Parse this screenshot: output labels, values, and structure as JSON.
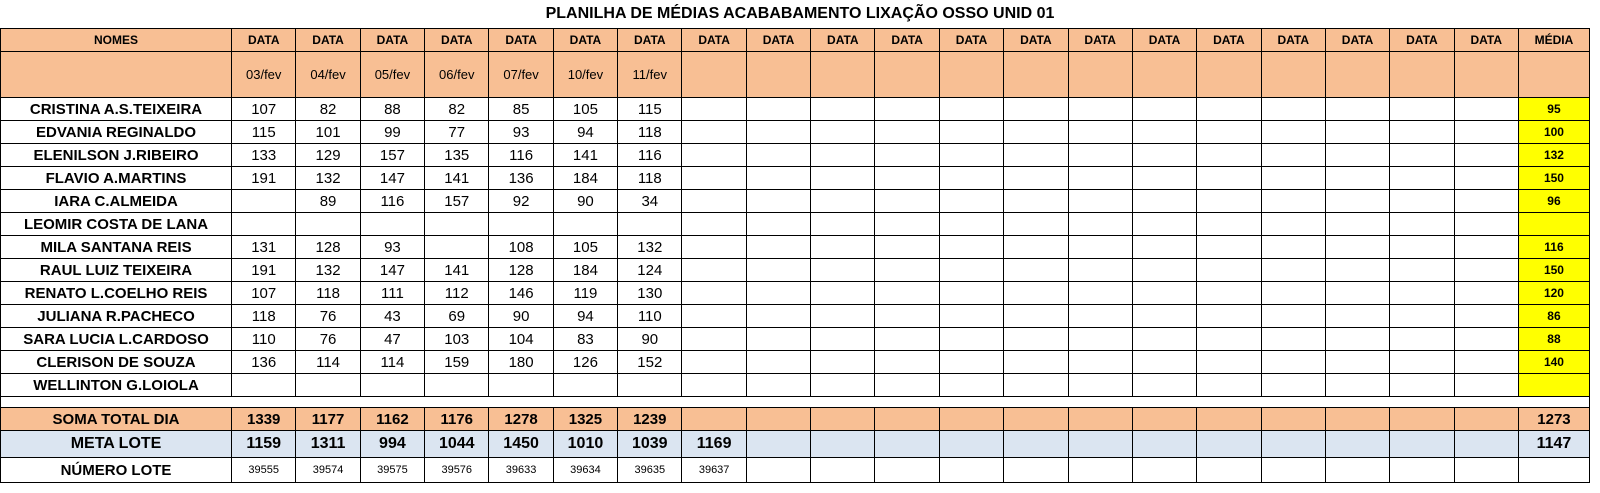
{
  "title": "PLANILHA DE MÉDIAS ACABABAMENTO LIXAÇÃO OSSO UNID 01",
  "header": {
    "nomes": "NOMES",
    "data_label": "DATA",
    "media": "MÉDIA",
    "dates": [
      "03/fev",
      "04/fev",
      "05/fev",
      "06/fev",
      "07/fev",
      "10/fev",
      "11/fev",
      "",
      "",
      "",
      "",
      "",
      "",
      "",
      "",
      "",
      "",
      "",
      "",
      ""
    ]
  },
  "rows": [
    {
      "name": "CRISTINA A.S.TEIXEIRA",
      "values": [
        "107",
        "82",
        "88",
        "82",
        "85",
        "105",
        "115"
      ],
      "media": "95"
    },
    {
      "name": "EDVANIA REGINALDO",
      "values": [
        "115",
        "101",
        "99",
        "77",
        "93",
        "94",
        "118"
      ],
      "media": "100"
    },
    {
      "name": "ELENILSON J.RIBEIRO",
      "values": [
        "133",
        "129",
        "157",
        "135",
        "116",
        "141",
        "116"
      ],
      "media": "132"
    },
    {
      "name": "FLAVIO A.MARTINS",
      "values": [
        "191",
        "132",
        "147",
        "141",
        "136",
        "184",
        "118"
      ],
      "media": "150"
    },
    {
      "name": "IARA C.ALMEIDA",
      "values": [
        "",
        "89",
        "116",
        "157",
        "92",
        "90",
        "34"
      ],
      "media": "96"
    },
    {
      "name": "LEOMIR COSTA DE LANA",
      "values": [
        "",
        "",
        "",
        "",
        "",
        "",
        ""
      ],
      "media": ""
    },
    {
      "name": "MILA SANTANA REIS",
      "values": [
        "131",
        "128",
        "93",
        "",
        "108",
        "105",
        "132"
      ],
      "media": "116"
    },
    {
      "name": "RAUL LUIZ TEIXEIRA",
      "values": [
        "191",
        "132",
        "147",
        "141",
        "128",
        "184",
        "124"
      ],
      "media": "150"
    },
    {
      "name": "RENATO L.COELHO REIS",
      "values": [
        "107",
        "118",
        "111",
        "112",
        "146",
        "119",
        "130"
      ],
      "media": "120"
    },
    {
      "name": "JULIANA R.PACHECO",
      "values": [
        "118",
        "76",
        "43",
        "69",
        "90",
        "94",
        "110"
      ],
      "media": "86"
    },
    {
      "name": "SARA LUCIA L.CARDOSO",
      "values": [
        "110",
        "76",
        "47",
        "103",
        "104",
        "83",
        "90"
      ],
      "media": "88"
    },
    {
      "name": "CLERISON DE SOUZA",
      "values": [
        "136",
        "114",
        "114",
        "159",
        "180",
        "126",
        "152"
      ],
      "media": "140"
    },
    {
      "name": "WELLINTON G.LOIOLA",
      "values": [
        "",
        "",
        "",
        "",
        "",
        "",
        ""
      ],
      "media": ""
    }
  ],
  "soma": {
    "label": "SOMA TOTAL DIA",
    "values": [
      "1339",
      "1177",
      "1162",
      "1176",
      "1278",
      "1325",
      "1239"
    ],
    "media": "1273"
  },
  "meta": {
    "label": "META LOTE",
    "values": [
      "1159",
      "1311",
      "994",
      "1044",
      "1450",
      "1010",
      "1039",
      "1169"
    ],
    "media": "1147"
  },
  "lote": {
    "label": "NÚMERO LOTE",
    "values": [
      "39555",
      "39574",
      "39575",
      "39576",
      "39633",
      "39634",
      "39635",
      "39637"
    ],
    "media": ""
  },
  "colors": {
    "header_bg": "#f8bf94",
    "media_bg": "#ffff00",
    "meta_bg": "#dbe5f1"
  }
}
